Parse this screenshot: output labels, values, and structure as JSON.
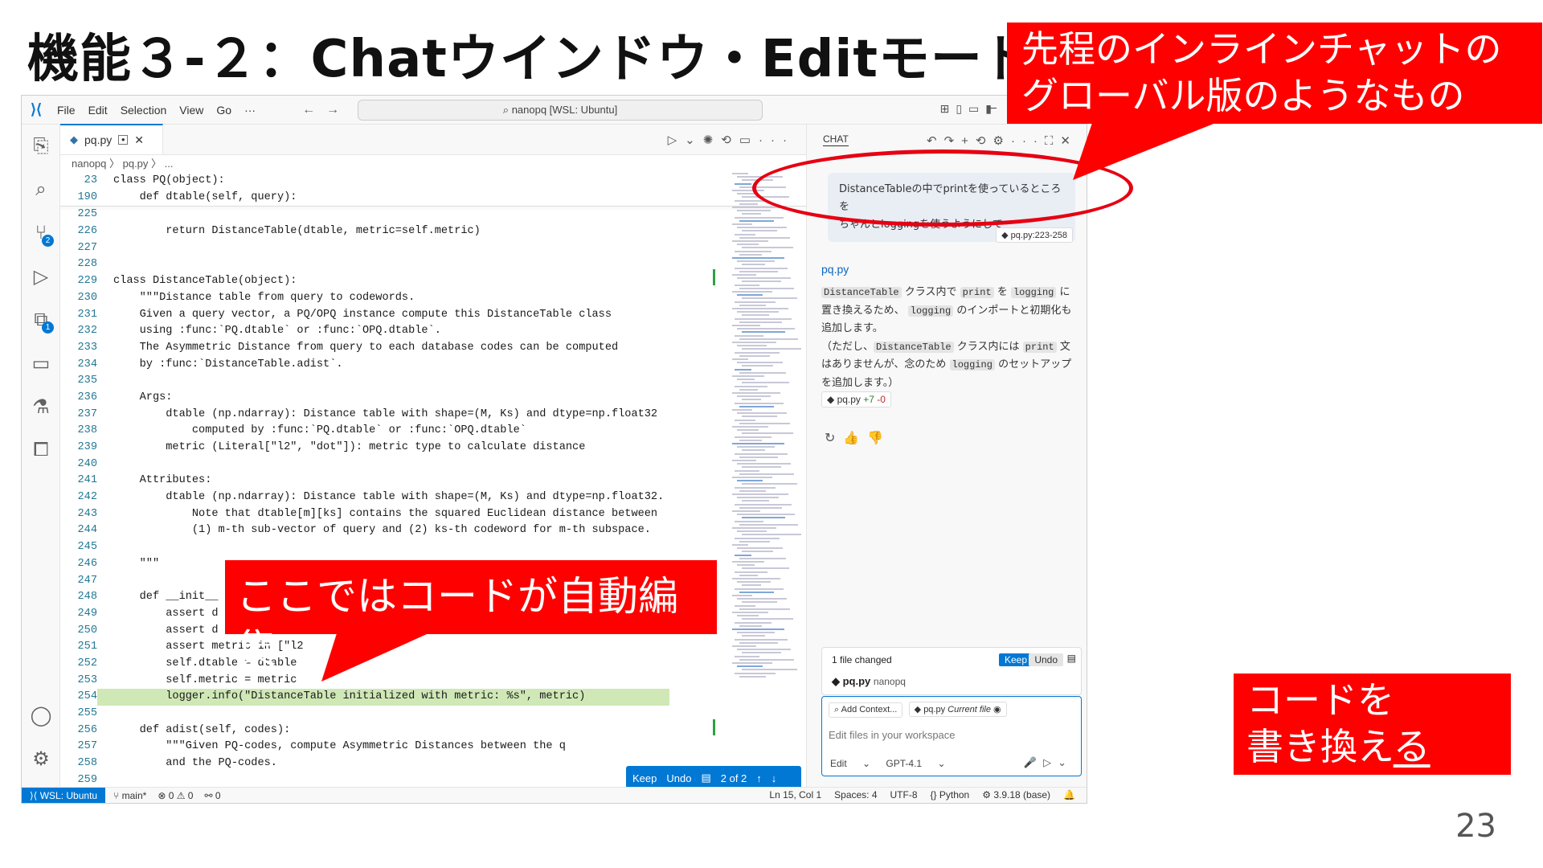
{
  "slide": {
    "title": "機能３-２：Chatウインドウ・Editモード",
    "page_number": "23",
    "callout_top_line1": "先程のインラインチャットの",
    "callout_top_line2": "グローバル版のようなもの",
    "callout_mid": "ここではコードが自動編集",
    "callout_br_line1": "コードを",
    "callout_br_line2a": "書き換え",
    "callout_br_line2b": "る",
    "accent_color": "#ff0000"
  },
  "titlebar": {
    "menus": [
      "File",
      "Edit",
      "Selection",
      "View",
      "Go"
    ],
    "more": "···",
    "search": "nanopq [WSL: Ubuntu]"
  },
  "editor": {
    "tab_label": "pq.py",
    "breadcrumb": "nanopq 〉 pq.py 〉 ...",
    "lines": [
      {
        "n": "23",
        "t": "class PQ(object):"
      },
      {
        "n": "190",
        "t": "    def dtable(self, query):"
      },
      {
        "n": "225",
        "t": ""
      },
      {
        "n": "226",
        "t": "        return DistanceTable(dtable, metric=self.metric)"
      },
      {
        "n": "227",
        "t": ""
      },
      {
        "n": "228",
        "t": ""
      },
      {
        "n": "229",
        "t": "class DistanceTable(object):"
      },
      {
        "n": "230",
        "t": "    \"\"\"Distance table from query to codewords."
      },
      {
        "n": "231",
        "t": "    Given a query vector, a PQ/OPQ instance compute this DistanceTable class"
      },
      {
        "n": "232",
        "t": "    using :func:`PQ.dtable` or :func:`OPQ.dtable`."
      },
      {
        "n": "233",
        "t": "    The Asymmetric Distance from query to each database codes can be computed"
      },
      {
        "n": "234",
        "t": "    by :func:`DistanceTable.adist`."
      },
      {
        "n": "235",
        "t": ""
      },
      {
        "n": "236",
        "t": "    Args:"
      },
      {
        "n": "237",
        "t": "        dtable (np.ndarray): Distance table with shape=(M, Ks) and dtype=np.float32"
      },
      {
        "n": "238",
        "t": "            computed by :func:`PQ.dtable` or :func:`OPQ.dtable`"
      },
      {
        "n": "239",
        "t": "        metric (Literal[\"l2\", \"dot\"]): metric type to calculate distance"
      },
      {
        "n": "240",
        "t": ""
      },
      {
        "n": "241",
        "t": "    Attributes:"
      },
      {
        "n": "242",
        "t": "        dtable (np.ndarray): Distance table with shape=(M, Ks) and dtype=np.float32."
      },
      {
        "n": "243",
        "t": "            Note that dtable[m][ks] contains the squared Euclidean distance between"
      },
      {
        "n": "244",
        "t": "            (1) m-th sub-vector of query and (2) ks-th codeword for m-th subspace."
      },
      {
        "n": "245",
        "t": ""
      },
      {
        "n": "246",
        "t": "    \"\"\""
      },
      {
        "n": "247",
        "t": ""
      },
      {
        "n": "248",
        "t": "    def __init__"
      },
      {
        "n": "249",
        "t": "        assert d"
      },
      {
        "n": "250",
        "t": "        assert d"
      },
      {
        "n": "251",
        "t": "        assert metric in [\"l2"
      },
      {
        "n": "252",
        "t": "        self.dtable = dtable"
      },
      {
        "n": "253",
        "t": "        self.metric = metric"
      },
      {
        "n": "254",
        "t": "        logger.info(\"DistanceTable initialized with metric: %s\", metric)"
      },
      {
        "n": "255",
        "t": ""
      },
      {
        "n": "256",
        "t": "    def adist(self, codes):"
      },
      {
        "n": "257",
        "t": "        \"\"\"Given PQ-codes, compute Asymmetric Distances between the q"
      },
      {
        "n": "258",
        "t": "        and the PQ-codes."
      },
      {
        "n": "259",
        "t": ""
      }
    ],
    "keep_bar": {
      "keep": "Keep",
      "undo": "Undo",
      "counter": "2 of 2"
    }
  },
  "chat": {
    "header": "CHAT",
    "user_msg_line1": "DistanceTableの中でprintを使っているところを",
    "user_msg_line2": "ちゃんとloggingを使うようにして",
    "ref_chip": "pq.py:223-258",
    "resp_title": "pq.py",
    "resp_p1_code1": "DistanceTable",
    "resp_p1_a": "クラス内で",
    "resp_p1_code2": "print",
    "resp_p1_b": "を",
    "resp_p1_code3": "logging",
    "resp_p1_c": "に置き換えるため、",
    "resp_p1_code4": "logging",
    "resp_p1_d": "のインポートと初期化も追加します。",
    "resp_p2_a": "（ただし、",
    "resp_p2_code1": "DistanceTable",
    "resp_p2_b": "クラス内には",
    "resp_p2_code2": "print",
    "resp_p2_c": "文はありませんが、念のため",
    "resp_p2_code3": "logging",
    "resp_p2_d": "のセットアップを追加します。）",
    "file_chip_name": "pq.py",
    "file_chip_add": "+7",
    "file_chip_del": "-0",
    "changed": "1 file changed",
    "keep": "Keep",
    "undo": "Undo",
    "changed_file": "pq.py",
    "changed_dir": "nanopq",
    "add_context": "Add Context...",
    "current_file": "pq.py",
    "current_file_tag": "Current file",
    "placeholder": "Edit files in your workspace",
    "mode": "Edit",
    "model": "GPT-4.1"
  },
  "statusbar": {
    "remote": "WSL: Ubuntu",
    "branch": "main*",
    "problems": "⊗ 0 ⚠ 0",
    "ports": "0",
    "position": "Ln 15, Col 1",
    "spaces": "Spaces: 4",
    "encoding": "UTF-8",
    "language": "Python",
    "env": "3.9.18 (base)"
  }
}
